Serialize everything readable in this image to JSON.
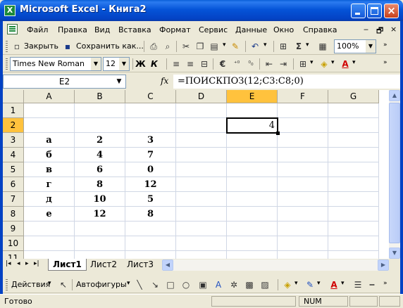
{
  "window": {
    "title": "Microsoft Excel - Книга2",
    "app_icon": "X"
  },
  "menubar": {
    "items": [
      "Файл",
      "Правка",
      "Вид",
      "Вставка",
      "Формат",
      "Сервис",
      "Данные",
      "Окно",
      "Справка"
    ],
    "mdi_minimize": "‒",
    "mdi_restore": "🗗",
    "mdi_close": "×"
  },
  "toolbar1": {
    "close_label": "Закрыть",
    "save_as_label": "Сохранить как...",
    "zoom": "100%"
  },
  "toolbar2": {
    "font_name": "Times New Roman",
    "font_size": "12",
    "bold": "Ж",
    "italic": "К"
  },
  "formula_bar": {
    "name_box": "E2",
    "fx": "fx",
    "formula": "=ПОИСКПОЗ(12;C3:C8;0)"
  },
  "grid": {
    "columns": [
      "A",
      "B",
      "C",
      "D",
      "E",
      "F",
      "G"
    ],
    "rows": [
      "1",
      "2",
      "3",
      "4",
      "5",
      "6",
      "7",
      "8",
      "9",
      "10",
      "11"
    ],
    "cells": {
      "E2": "4",
      "A3": "а",
      "B3": "2",
      "C3": "3",
      "A4": "б",
      "B4": "4",
      "C4": "7",
      "A5": "в",
      "B5": "6",
      "C5": "0",
      "A6": "г",
      "B6": "8",
      "C6": "12",
      "A7": "д",
      "B7": "10",
      "C7": "5",
      "A8": "е",
      "B8": "12",
      "C8": "8"
    },
    "active_cell": "E2"
  },
  "sheets": {
    "tabs": [
      "Лист1",
      "Лист2",
      "Лист3"
    ],
    "active": "Лист1"
  },
  "drawbar": {
    "actions_label": "Действия",
    "autoshapes_label": "Автофигуры"
  },
  "status": {
    "text": "Готово",
    "num": "NUM"
  }
}
